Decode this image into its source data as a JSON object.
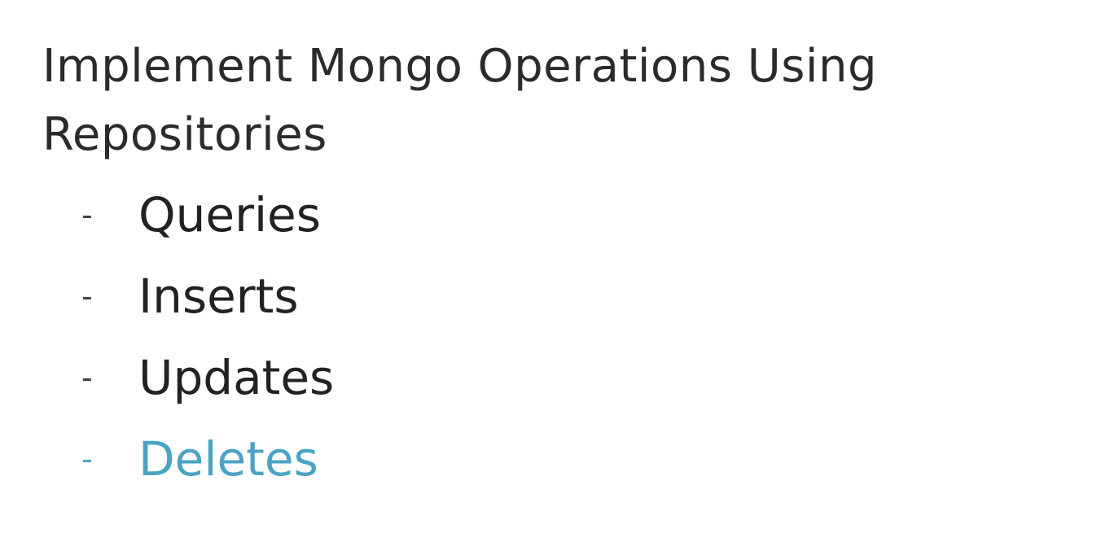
{
  "slide": {
    "title_line1": "Implement Mongo Operations Using",
    "title_line2": "Repositories",
    "bullet_marker": "-",
    "bullets": [
      {
        "label": "Queries",
        "active": false
      },
      {
        "label": "Inserts",
        "active": false
      },
      {
        "label": "Updates",
        "active": false
      },
      {
        "label": "Deletes",
        "active": true
      }
    ],
    "colors": {
      "text": "#222222",
      "highlight": "#4aa3c4",
      "background": "#ffffff"
    }
  }
}
